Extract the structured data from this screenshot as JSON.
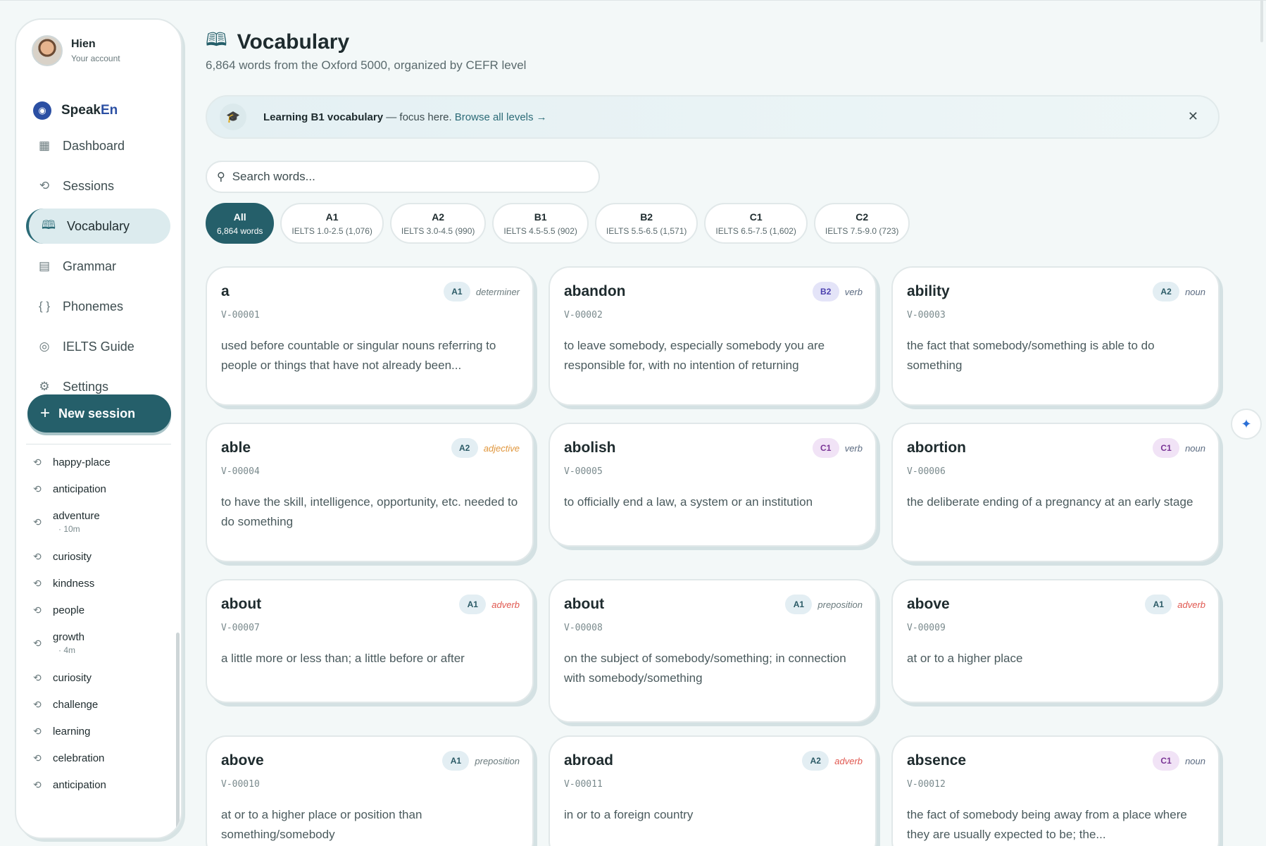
{
  "user": {
    "name": "Hien",
    "subtitle": "Your account"
  },
  "brand": {
    "name_part1": "Speak",
    "name_part2": "En"
  },
  "nav": [
    {
      "label": "Dashboard",
      "icon": "dashboard-icon",
      "glyph": "▦"
    },
    {
      "label": "Sessions",
      "icon": "history-icon",
      "glyph": "⟲"
    },
    {
      "label": "Vocabulary",
      "icon": "book-icon",
      "glyph": "🕮",
      "active": true
    },
    {
      "label": "Grammar",
      "icon": "bookmark-book-icon",
      "glyph": "▤"
    },
    {
      "label": "Phonemes",
      "icon": "braces-icon",
      "glyph": "{ }"
    },
    {
      "label": "IELTS Guide",
      "icon": "target-icon",
      "glyph": "◎"
    },
    {
      "label": "Settings",
      "icon": "gear-icon",
      "glyph": "⚙"
    }
  ],
  "new_session": {
    "label": "New session",
    "icon": "plus-icon"
  },
  "history": [
    {
      "label": "happy-place",
      "meta": ""
    },
    {
      "label": "anticipation",
      "meta": ""
    },
    {
      "label": "adventure",
      "meta": "· 10m"
    },
    {
      "label": "curiosity",
      "meta": ""
    },
    {
      "label": "kindness",
      "meta": ""
    },
    {
      "label": "people",
      "meta": ""
    },
    {
      "label": "growth",
      "meta": "· 4m"
    },
    {
      "label": "curiosity",
      "meta": ""
    },
    {
      "label": "challenge",
      "meta": ""
    },
    {
      "label": "learning",
      "meta": ""
    },
    {
      "label": "celebration",
      "meta": ""
    },
    {
      "label": "anticipation",
      "meta": ""
    }
  ],
  "page": {
    "title": "Vocabulary",
    "subtitle": "6,864 words from the Oxford 5000, organized by CEFR level"
  },
  "banner": {
    "strong": "Learning B1 vocabulary",
    "text": " — focus here. ",
    "link": "Browse all levels →",
    "close": "✕"
  },
  "search": {
    "placeholder": "Search words...",
    "value": ""
  },
  "filters": [
    {
      "level": "All",
      "sub": "6,864 words",
      "active": true
    },
    {
      "level": "A1",
      "sub": "IELTS 1.0-2.5 (1,076)"
    },
    {
      "level": "A2",
      "sub": "IELTS 3.0-4.5 (990)"
    },
    {
      "level": "B1",
      "sub": "IELTS 4.5-5.5 (902)"
    },
    {
      "level": "B2",
      "sub": "IELTS 5.5-6.5 (1,571)"
    },
    {
      "level": "C1",
      "sub": "IELTS 6.5-7.5 (1,602)"
    },
    {
      "level": "C2",
      "sub": "IELTS 7.5-9.0 (723)"
    }
  ],
  "level_colors": {
    "A1": {
      "bg": "#e3eef3",
      "fg": "#2b5a66"
    },
    "A2": {
      "bg": "#e3eef3",
      "fg": "#2b5a66"
    },
    "B2": {
      "bg": "#e4e4f8",
      "fg": "#4b3fae"
    },
    "C1": {
      "bg": "#f1e3f6",
      "fg": "#7a3596"
    }
  },
  "pos_colors": {
    "determiner": "#6a7a7d",
    "verb": "#5a6a80",
    "noun": "#5a6a80",
    "adjective": "#e0963c",
    "adverb": "#e0574f",
    "preposition": "#6a7a7d"
  },
  "cards": [
    {
      "word": "a",
      "level": "A1",
      "pos": "determiner",
      "code": "V-00001",
      "def": "used before countable or singular nouns referring to people or things that have not already been..."
    },
    {
      "word": "abandon",
      "level": "B2",
      "pos": "verb",
      "code": "V-00002",
      "def": "to leave somebody, especially somebody you are responsible for, with no intention of returning"
    },
    {
      "word": "ability",
      "level": "A2",
      "pos": "noun",
      "code": "V-00003",
      "def": "the fact that somebody/something is able to do something"
    },
    {
      "word": "able",
      "level": "A2",
      "pos": "adjective",
      "code": "V-00004",
      "def": "to have the skill, intelligence, opportunity, etc. needed to do something"
    },
    {
      "word": "abolish",
      "level": "C1",
      "pos": "verb",
      "code": "V-00005",
      "def": "to officially end a law, a system or an institution"
    },
    {
      "word": "abortion",
      "level": "C1",
      "pos": "noun",
      "code": "V-00006",
      "def": "the deliberate ending of a pregnancy at an early stage"
    },
    {
      "word": "about",
      "level": "A1",
      "pos": "adverb",
      "code": "V-00007",
      "def": "a little more or less than; a little before or after"
    },
    {
      "word": "about",
      "level": "A1",
      "pos": "preposition",
      "code": "V-00008",
      "def": "on the subject of somebody/something; in connection with somebody/something"
    },
    {
      "word": "above",
      "level": "A1",
      "pos": "adverb",
      "code": "V-00009",
      "def": "at or to a higher place"
    },
    {
      "word": "above",
      "level": "A1",
      "pos": "preposition",
      "code": "V-00010",
      "def": "at or to a higher place or position than something/somebody"
    },
    {
      "word": "abroad",
      "level": "A2",
      "pos": "adverb",
      "code": "V-00011",
      "def": "in or to a foreign country"
    },
    {
      "word": "absence",
      "level": "C1",
      "pos": "noun",
      "code": "V-00012",
      "def": "the fact of somebody being away from a place where they are usually expected to be; the..."
    }
  ],
  "float_button": {
    "icon": "sparkle-drop-icon",
    "glyph": "✦"
  }
}
